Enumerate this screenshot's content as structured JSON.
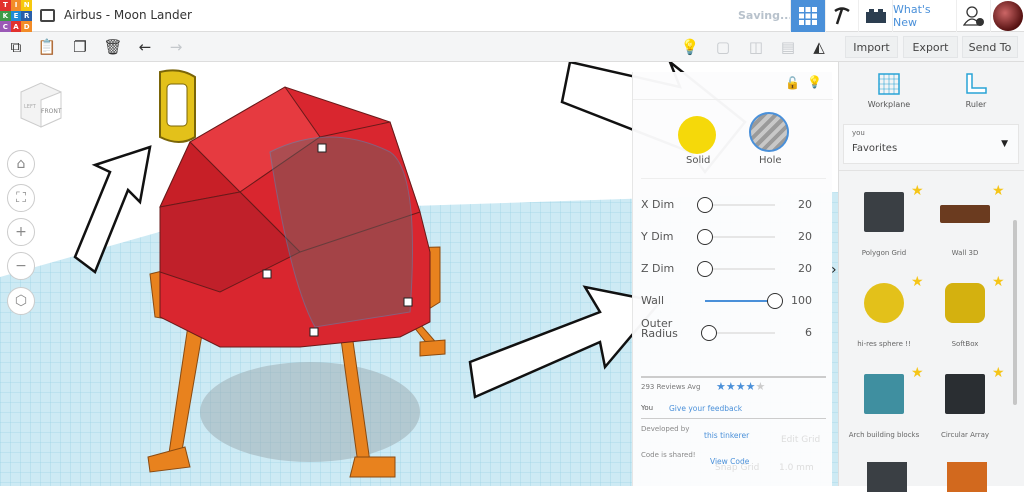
{
  "app": {
    "logo_letters": [
      "TIN",
      "KER",
      "CAD"
    ],
    "title": "Airbus - Moon Lander",
    "status": "Saving...",
    "whats_new": "What's New"
  },
  "toolbar": {
    "import": "Import",
    "export": "Export",
    "send_to": "Send To"
  },
  "inspector": {
    "solid_label": "Solid",
    "hole_label": "Hole",
    "params": [
      {
        "label": "X Dim",
        "value": "20",
        "fraction": 0
      },
      {
        "label": "Y Dim",
        "value": "20",
        "fraction": 0
      },
      {
        "label": "Z Dim",
        "value": "20",
        "fraction": 0
      },
      {
        "label": "Wall",
        "value": "100",
        "fraction": 1
      },
      {
        "label": "Outer Radius",
        "value": "6",
        "fraction": 0.05
      }
    ],
    "reviews": "293 Reviews Avg",
    "rating": 4,
    "you": "You",
    "feedback": "Give your feedback",
    "developed_by": "Developed by",
    "developer": "this tinkerer",
    "code_shared": "Code is shared!",
    "view_code": "View Code",
    "edit_grid": "Edit Grid",
    "snap_grid": "Snap Grid",
    "snap_value": "1.0 mm"
  },
  "viewcube": {
    "front": "FRONT",
    "left": "LEFT"
  },
  "rightpanel": {
    "workplane": "Workplane",
    "ruler": "Ruler",
    "category_owner": "you",
    "category": "Favorites",
    "shapes": [
      {
        "name": "Polygon Grid"
      },
      {
        "name": "Wall 3D"
      },
      {
        "name": "hi-res sphere !!"
      },
      {
        "name": "SoftBox"
      },
      {
        "name": "Arch building blocks"
      },
      {
        "name": "Circular Array"
      }
    ]
  },
  "colors": {
    "accent": "#4a90d9",
    "model_red": "#d9262f",
    "orange": "#e8821e",
    "yellow": "#e3c11a"
  }
}
